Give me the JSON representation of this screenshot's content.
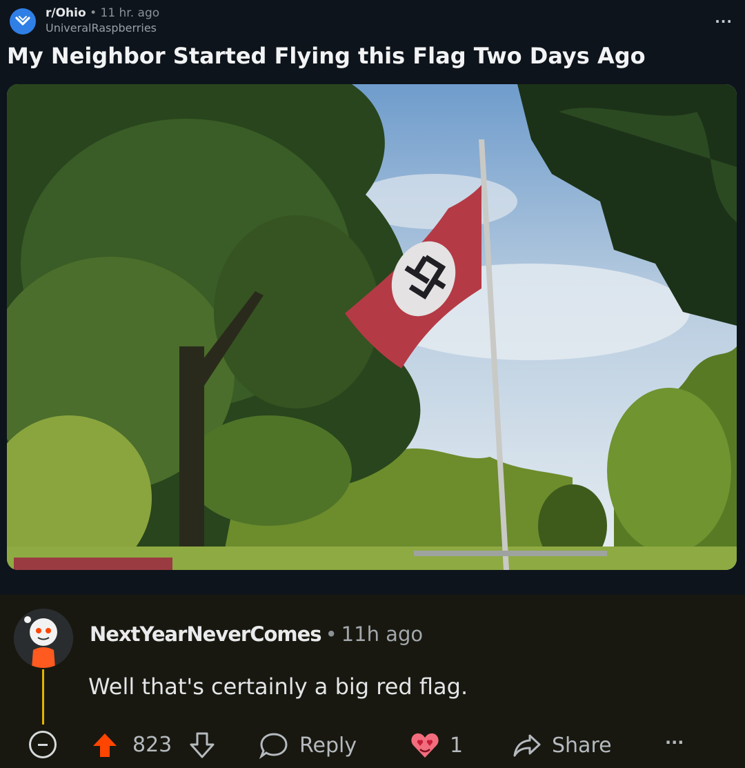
{
  "post": {
    "subreddit": "r/Ohio",
    "separator": "•",
    "age": "11 hr. ago",
    "author": "UniveralRaspberries",
    "more_label": "...",
    "title": "My Neighbor Started Flying this Flag Two Days Ago",
    "media": {
      "kind": "video-thumbnail",
      "icon": "play-icon"
    }
  },
  "comment": {
    "username": "NextYearNeverComes",
    "separator": "•",
    "age": "11h ago",
    "body": "Well that's certainly a big red flag.",
    "actions": {
      "collapse_icon": "minus-circle-icon",
      "upvote_icon": "upvote-arrow-icon",
      "score": "823",
      "downvote_icon": "downvote-arrow-icon",
      "reply_icon": "speech-bubble-icon",
      "reply_label": "Reply",
      "award_icon": "heart-eyes-award-icon",
      "award_count": "1",
      "share_icon": "share-arrow-icon",
      "share_label": "Share",
      "more_label": "..."
    }
  },
  "colors": {
    "upvote": "#ff4500",
    "thread_line": "#e3b400",
    "subreddit_icon": "#2f7fe6"
  }
}
